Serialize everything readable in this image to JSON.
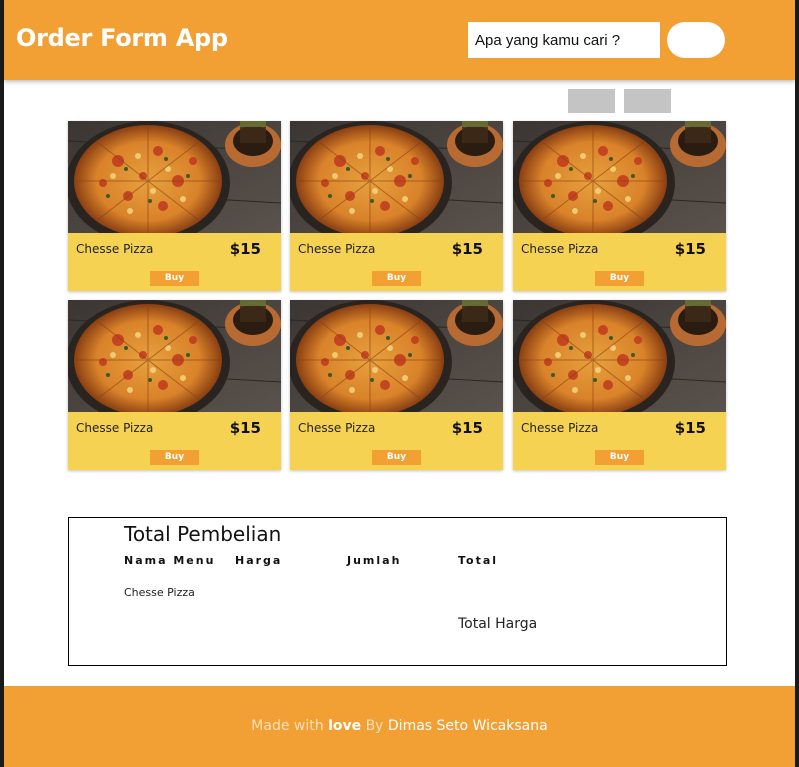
{
  "header": {
    "title": "Order Form App",
    "search_placeholder": "Apa yang kamu cari ?",
    "search_value": "",
    "search_button_label": ""
  },
  "pager": {
    "prev_label": "",
    "next_label": ""
  },
  "products": [
    {
      "name": "Chesse Pizza",
      "price": "$15",
      "buy_label": "Buy"
    },
    {
      "name": "Chesse Pizza",
      "price": "$15",
      "buy_label": "Buy"
    },
    {
      "name": "Chesse Pizza",
      "price": "$15",
      "buy_label": "Buy"
    },
    {
      "name": "Chesse Pizza",
      "price": "$15",
      "buy_label": "Buy"
    },
    {
      "name": "Chesse Pizza",
      "price": "$15",
      "buy_label": "Buy"
    },
    {
      "name": "Chesse Pizza",
      "price": "$15",
      "buy_label": "Buy"
    }
  ],
  "summary": {
    "title": "Total Pembelian",
    "columns": [
      "Nama Menu",
      "Harga",
      "Jumlah",
      "Total"
    ],
    "rows": [
      {
        "name": "Chesse Pizza"
      }
    ],
    "total_label": "Total Harga"
  },
  "footer": {
    "made_with": "Made with",
    "love": "love",
    "by": "By",
    "author": "Dimas Seto Wicaksana"
  },
  "colors": {
    "accent": "#f29f34",
    "card": "#f5d251",
    "pager": "#c4c4c4"
  }
}
